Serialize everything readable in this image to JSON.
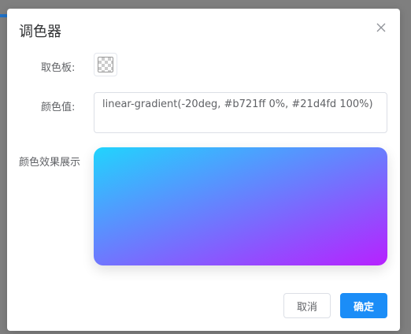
{
  "dialog": {
    "title": "调色器",
    "close_icon": "close-icon"
  },
  "form": {
    "picker_label": "取色板:",
    "value_label": "颜色值:",
    "preview_label": "颜色效果展示",
    "color_value": "linear-gradient(-20deg, #b721ff 0%, #21d4fd 100%)",
    "swatch_icon": "transparent-checker-icon"
  },
  "gradient": {
    "angle": "-20deg",
    "start_color": "#b721ff",
    "end_color": "#21d4fd"
  },
  "footer": {
    "cancel_label": "取消",
    "confirm_label": "确定"
  },
  "colors": {
    "primary": "#1b8df7",
    "border": "#dcdfe6",
    "overlay": "#7f7f7f"
  }
}
